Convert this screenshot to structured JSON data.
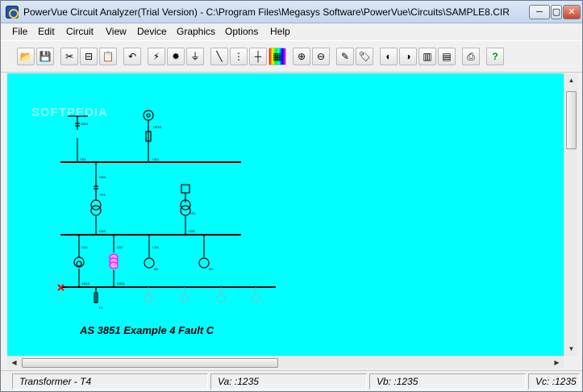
{
  "window": {
    "title": "PowerVue Circuit Analyzer(Trial Version) - C:\\Program Files\\Megasys Software\\PowerVue\\Circuits\\SAMPLE8.CIR",
    "min_glyph": "─",
    "max_glyph": "▢",
    "close_glyph": "✕"
  },
  "menu": [
    "File",
    "Edit",
    "Circuit",
    "View",
    "Device",
    "Graphics",
    "Options",
    "Help"
  ],
  "toolbar": {
    "buttons": [
      {
        "name": "open-circuit",
        "glyph": "📂"
      },
      {
        "name": "save-circuit",
        "glyph": "💾"
      },
      {
        "name": "wire-tool",
        "glyph": "✂"
      },
      {
        "name": "breaker-tool",
        "glyph": "⊟"
      },
      {
        "name": "paste",
        "glyph": "📋"
      },
      {
        "name": "undo",
        "glyph": "↶"
      },
      {
        "name": "fault",
        "glyph": "⚡"
      },
      {
        "name": "short-circuit",
        "glyph": "✸"
      },
      {
        "name": "earth",
        "glyph": "⏚"
      },
      {
        "name": "draw-line",
        "glyph": "╲"
      },
      {
        "name": "grid",
        "glyph": "⋮"
      },
      {
        "name": "snap",
        "glyph": "┼"
      },
      {
        "name": "palette",
        "glyph": "▦"
      },
      {
        "name": "zoom-in",
        "glyph": "⊕"
      },
      {
        "name": "zoom-out",
        "glyph": "⊖"
      },
      {
        "name": "probe",
        "glyph": "✎"
      },
      {
        "name": "tag",
        "glyph": "🏷"
      },
      {
        "name": "motor-start",
        "glyph": "◐"
      },
      {
        "name": "motor-run",
        "glyph": "◑"
      },
      {
        "name": "relay-a",
        "glyph": "▥"
      },
      {
        "name": "relay-b",
        "glyph": "▤"
      },
      {
        "name": "print",
        "glyph": "⎙"
      },
      {
        "name": "help",
        "glyph": "?"
      }
    ]
  },
  "watermark": "SOFTPEDIA",
  "diagram": {
    "caption": "AS 3851 Example 4 Fault C",
    "labels": {
      "src": "G/N1",
      "src2": "GEN1",
      "cb1": "CB1",
      "cb2": "CB2",
      "cb3": "CB3",
      "tr1": "TR1",
      "tr2": "TR2",
      "cb4": "CB4",
      "cb5": "CB5",
      "cb6": "CB6",
      "cb7": "CB7",
      "cb8": "CB8",
      "m1": "M1",
      "m2": "M2",
      "cb10": "CB10",
      "cb11": "CB11",
      "f1": "F1",
      "m3": "M3",
      "m4": "M4",
      "m5": "M5",
      "m6": "M6"
    },
    "colors": {
      "line": "#000000",
      "fault": "#ff0000",
      "device": "#ff00ff",
      "dim": "#7fbfbf"
    }
  },
  "status": {
    "device": "Transformer - T4",
    "va": "Va: :1235",
    "vb": "Vb: :1235",
    "vc": "Vc: :1235"
  }
}
